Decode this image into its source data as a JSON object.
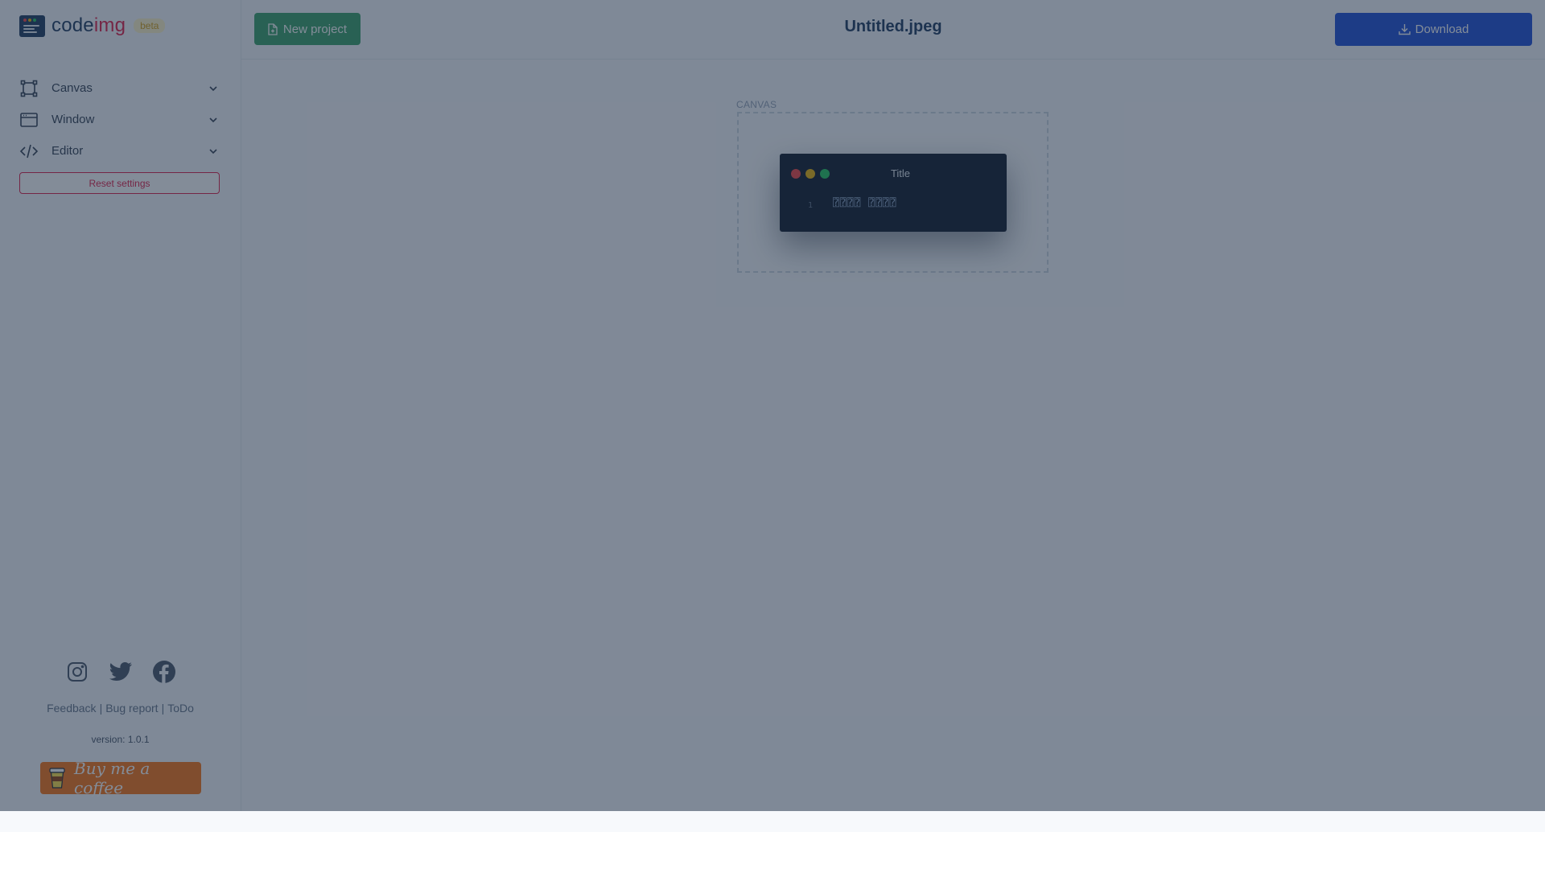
{
  "app": {
    "name_code": "code",
    "name_img": "img",
    "badge": "beta"
  },
  "sidebar": {
    "items": [
      {
        "label": "Canvas",
        "icon": "canvas-frame-icon"
      },
      {
        "label": "Window",
        "icon": "window-icon"
      },
      {
        "label": "Editor",
        "icon": "code-brackets-icon"
      }
    ],
    "reset_label": "Reset settings",
    "social_icons": [
      "instagram-icon",
      "twitter-icon",
      "facebook-icon"
    ],
    "links": {
      "feedback": "Feedback",
      "bug_report": "Bug report",
      "todo": "ToDo",
      "separator": "|"
    },
    "version": "version: 1.0.1",
    "coffee_label": "Buy me a coffee"
  },
  "header": {
    "new_project_label": "New project",
    "file_name": "Untitled.jpeg",
    "download_label": "Download"
  },
  "canvas": {
    "label": "CANVAS",
    "window": {
      "title": "Title",
      "line_number": "1",
      "code_text": "⍰⍰⍰⍰ ⍰⍰⍰⍰"
    }
  },
  "colors": {
    "accent_green": "#38a169",
    "accent_blue": "#1d4ed8",
    "accent_red": "#e11d48",
    "coffee_orange": "#f97316",
    "window_bg": "#0f1a2a",
    "traffic_red": "#ef4444",
    "traffic_yellow": "#eab308",
    "traffic_green": "#22c55e",
    "overlay": "rgba(30, 45, 68, 0.55)"
  }
}
